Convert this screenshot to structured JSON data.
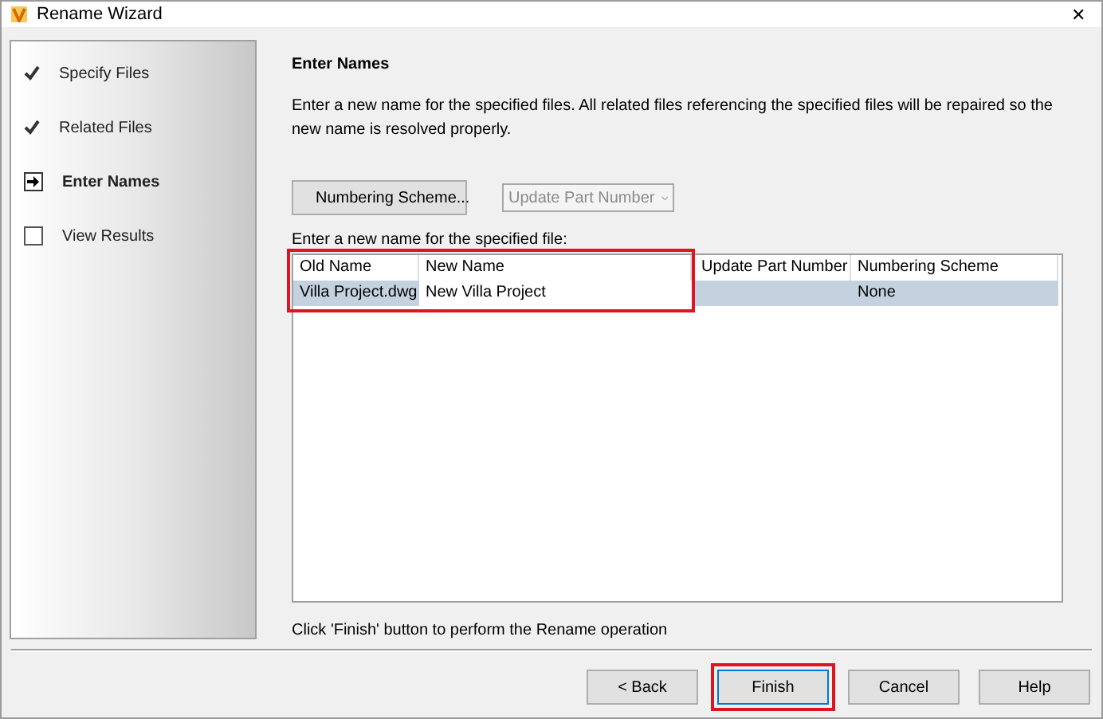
{
  "window": {
    "title": "Rename Wizard",
    "close": "✕"
  },
  "steps": [
    {
      "label": "Specify Files",
      "kind": "done",
      "selected": false
    },
    {
      "label": "Related Files",
      "kind": "done",
      "selected": false
    },
    {
      "label": "Enter Names",
      "kind": "current",
      "selected": true
    },
    {
      "label": "View Results",
      "kind": "pending",
      "selected": false
    }
  ],
  "heading": "Enter Names",
  "intro": "Enter a new name for the specified files.  All related files referencing the specified files will be repaired so the new name is resolved properly.",
  "numbering_button": "Numbering Scheme...",
  "part_number_dropdown": {
    "value": "Update Part Number",
    "disabled": true
  },
  "table_caption": "Enter a new name for the specified file:",
  "table": {
    "columns": [
      "Old Name",
      "New Name",
      "Update Part Number",
      "Numbering Scheme"
    ],
    "rows": [
      {
        "selected": true,
        "cells": [
          "Villa Project.dwg",
          "New Villa Project",
          "",
          "None"
        ]
      }
    ]
  },
  "hint": "Click 'Finish' button to perform the Rename operation",
  "buttons": [
    {
      "label": "< Back",
      "focused": false,
      "highlighted": false
    },
    {
      "label": "Finish",
      "focused": true,
      "highlighted": true
    },
    {
      "label": "Cancel",
      "focused": false,
      "highlighted": false
    },
    {
      "label": "Help",
      "focused": false,
      "highlighted": false
    }
  ]
}
